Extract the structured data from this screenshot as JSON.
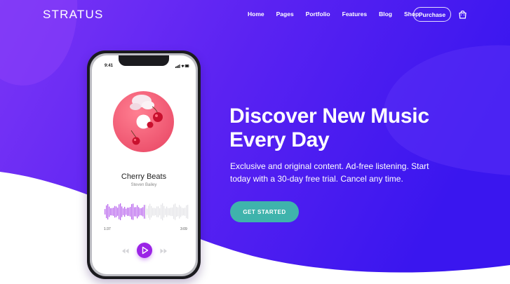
{
  "brand": {
    "name": "STRATUS"
  },
  "nav": {
    "items": [
      {
        "label": "Home"
      },
      {
        "label": "Pages"
      },
      {
        "label": "Portfolio"
      },
      {
        "label": "Features"
      },
      {
        "label": "Blog"
      },
      {
        "label": "Shop"
      }
    ],
    "purchase_label": "Purchase",
    "cart_icon": "shopping-bag-icon"
  },
  "hero": {
    "headline_line1": "Discover New Music",
    "headline_line2": "Every Day",
    "lead_line1": "Exclusive and original content. Ad-free listening. Start",
    "lead_line2": "today with a 30-day free trial. Cancel any time.",
    "cta_label": "GET STARTED"
  },
  "phone": {
    "status_time": "9:41",
    "track_title": "Cherry Beats",
    "track_artist": "Steven Bailey",
    "time_elapsed": "1:37",
    "time_total": "3:09",
    "progress": 0.47,
    "icons": [
      "rewind-icon",
      "play-icon",
      "fast-forward-icon"
    ]
  },
  "colors": {
    "gradient_start": "#6a2ef5",
    "gradient_end": "#3d16f0",
    "accent_purple": "#9b24e6",
    "cta_teal": "#3fb3ac",
    "album_pink": "#f0607a"
  }
}
